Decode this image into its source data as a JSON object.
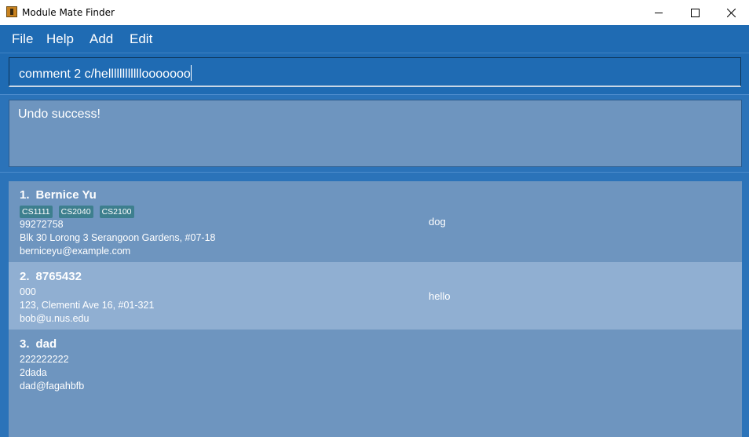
{
  "window": {
    "title": "Module Mate Finder"
  },
  "menu": [
    "File",
    "Help",
    "Add",
    "Edit"
  ],
  "command_box": {
    "value": "comment 2 c/hellllllllllllooooooo"
  },
  "result_display": {
    "text": "Undo success!"
  },
  "persons": [
    {
      "index": "1.",
      "name": "Bernice Yu",
      "tags": [
        "CS1111",
        "CS2040",
        "CS2100"
      ],
      "phone": "99272758",
      "address": "Blk 30 Lorong 3 Serangoon Gardens, #07-18",
      "email": "berniceyu@example.com",
      "comment": "dog"
    },
    {
      "index": "2.",
      "name": "8765432",
      "tags": [],
      "phone": "000",
      "address": "123, Clementi Ave 16, #01-321",
      "email": "bob@u.nus.edu",
      "comment": "hello"
    },
    {
      "index": "3.",
      "name": "dad",
      "tags": [],
      "phone": "222222222",
      "address": "2dada",
      "email": "dad@fagahbfb",
      "comment": ""
    }
  ],
  "colors": {
    "primary": "#1f6bb3",
    "panel": "#6e95bf",
    "selected_row": "#90afd2",
    "tag": "#3d7f8e"
  },
  "icons": {
    "app": "app-icon",
    "minimize": "minimize-icon",
    "maximize": "maximize-icon",
    "close": "close-icon"
  }
}
